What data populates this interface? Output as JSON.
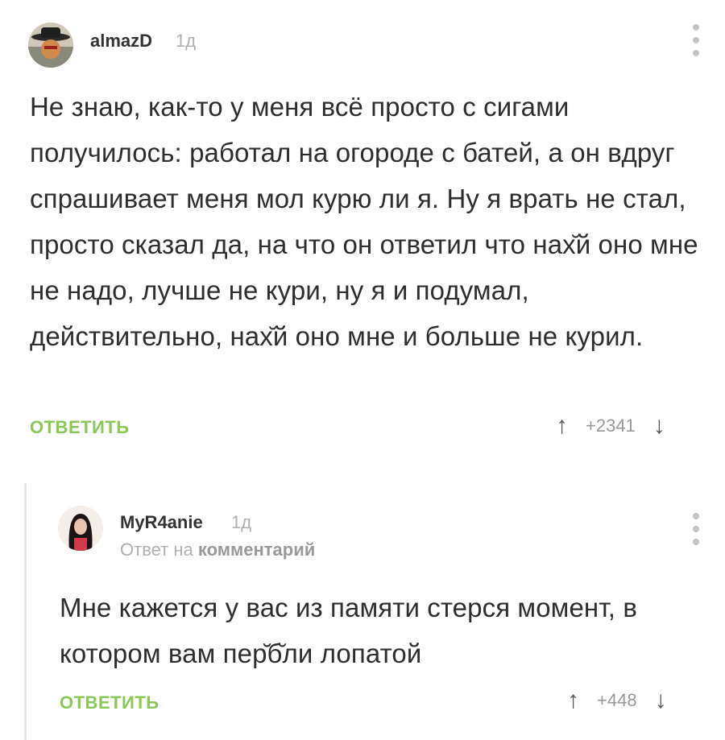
{
  "comments": [
    {
      "username": "almazD",
      "time": "1д",
      "text": "Не знаю, как-то у меня всё просто с сигами получилось: работал на огороде с батей, а он вдруг спрашивает меня мол курю ли я. Ну я врать не стал, просто сказал да, на что он ответил что нах̆й оно мне не надо, лучше не кури, ну я и подумал, действительно, нах̆й оно мне и больше не курил.",
      "reply_label": "ОТВЕТИТЬ",
      "score": "+2341",
      "upvote_icon": "arrow-up-icon",
      "downvote_icon": "arrow-down-icon"
    },
    {
      "username": "MyR4anie",
      "time": "1д",
      "reply_to_prefix": "Ответ на",
      "reply_to_link": "комментарий",
      "text": "Мне кажется у вас из памяти стерся момент, в котором вам пер̆̆б̆ли лопатой",
      "reply_label": "ОТВЕТИТЬ",
      "score": "+448",
      "upvote_icon": "arrow-up-icon",
      "downvote_icon": "arrow-down-icon"
    }
  ],
  "colors": {
    "accent": "#8ac858",
    "muted": "#b0b0b0",
    "text": "#2e2e2e"
  }
}
